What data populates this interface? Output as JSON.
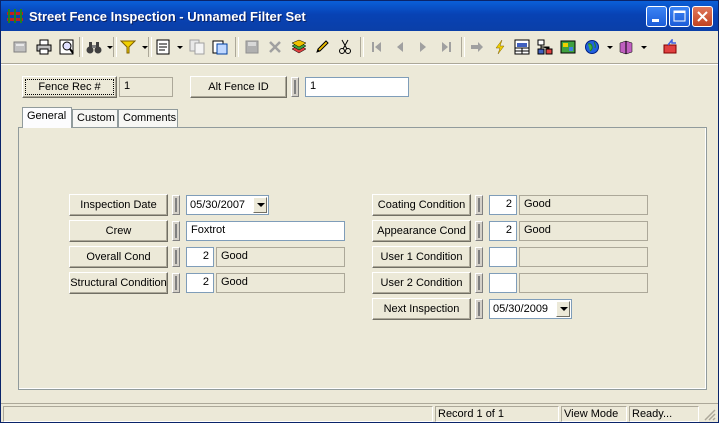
{
  "window": {
    "title": "Street Fence Inspection - Unnamed Filter Set",
    "accent": "#0842b4"
  },
  "header": {
    "fence_rec_label": "Fence Rec #",
    "fence_rec_value": "1",
    "alt_fence_id_label": "Alt Fence ID",
    "alt_fence_id_value": "1"
  },
  "tabs": [
    {
      "label": "General"
    },
    {
      "label": "Custom"
    },
    {
      "label": "Comments"
    }
  ],
  "general": {
    "inspection_date": {
      "label": "Inspection Date",
      "value": "05/30/2007"
    },
    "crew": {
      "label": "Crew",
      "value": "Foxtrot"
    },
    "overall_cond": {
      "label": "Overall Cond",
      "code": "2",
      "text": "Good"
    },
    "structural_condition": {
      "label": "Structural Condition",
      "code": "2",
      "text": "Good"
    },
    "coating_condition": {
      "label": "Coating Condition",
      "code": "2",
      "text": "Good"
    },
    "appearance_cond": {
      "label": "Appearance Cond",
      "code": "2",
      "text": "Good"
    },
    "user1_condition": {
      "label": "User 1 Condition",
      "code": "",
      "text": ""
    },
    "user2_condition": {
      "label": "User 2 Condition",
      "code": "",
      "text": ""
    },
    "next_inspection": {
      "label": "Next Inspection",
      "value": "05/30/2009"
    }
  },
  "status": {
    "record": "Record 1 of 1",
    "mode": "View Mode",
    "state": "Ready..."
  }
}
